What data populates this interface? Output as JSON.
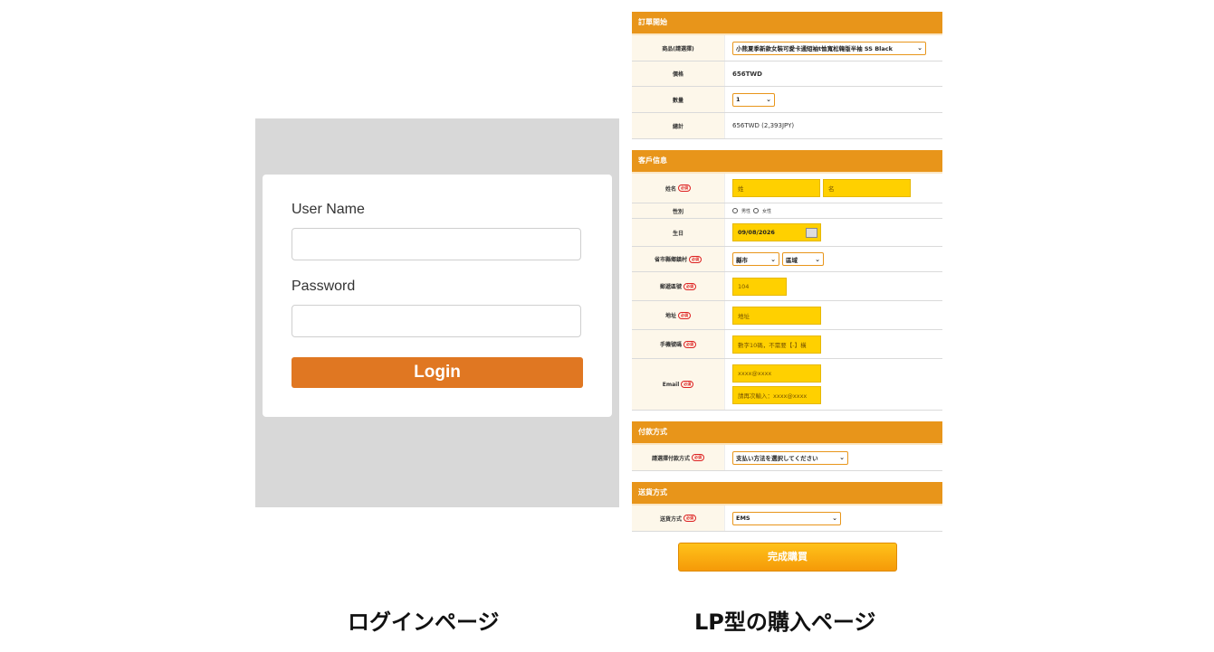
{
  "login": {
    "username_label": "User Name",
    "password_label": "Password",
    "login_label": "Login"
  },
  "lp": {
    "order": {
      "header": "訂單開始",
      "product_label": "商品(請選擇)",
      "product_value": "小熊夏季新款女裝可愛卡通短袖t恤寬松韓版半袖 SS Black",
      "price_label": "價格",
      "price_value": "656TWD",
      "qty_label": "數量",
      "qty_value": "1",
      "total_label": "總計",
      "total_value": "656TWD (2,393JPY)"
    },
    "customer": {
      "header": "客戶信息",
      "required": "必須",
      "name_label": "姓名",
      "last_placeholder": "姓",
      "first_placeholder": "名",
      "gender_label": "性別",
      "gender_male": "男性",
      "gender_female": "女性",
      "birthday_label": "生日",
      "birthday_value": "09/08/2026",
      "region_label": "省市縣鄉鎮村",
      "city_value": "縣市",
      "district_value": "區域",
      "postal_label": "郵遞區號",
      "postal_placeholder": "104",
      "address_label": "地址",
      "address_placeholder": "地址",
      "phone_label": "手機號碼",
      "phone_placeholder": "數字10碼，不需要【-】橫",
      "email_label": "Email",
      "email_placeholder": "xxxx@xxxx",
      "email_confirm_placeholder": "請再次輸入：xxxx@xxxx"
    },
    "payment": {
      "header": "付款方式",
      "method_label": "請選擇付款方式",
      "method_value": "支払い方法を選択してください"
    },
    "shipping": {
      "header": "送貨方式",
      "method_label": "送貨方式",
      "method_value": "EMS"
    },
    "submit_label": "完成購買"
  },
  "captions": {
    "login_page": "ログインページ",
    "lp_page": "LP型の購入ページ"
  },
  "colors": {
    "accent_orange": "#e07722",
    "section_orange": "#e8951a",
    "input_yellow": "#ffd000"
  }
}
